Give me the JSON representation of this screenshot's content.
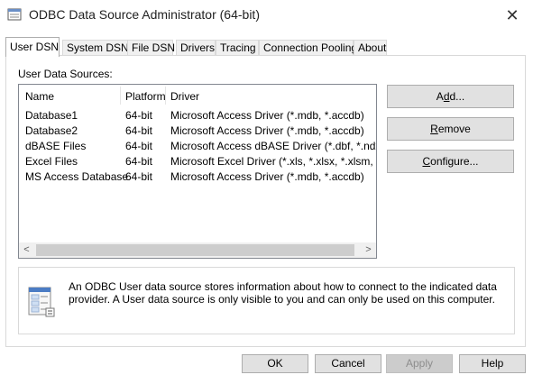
{
  "window": {
    "title": "ODBC Data Source Administrator (64-bit)",
    "close_glyph": "✕"
  },
  "tabs": [
    {
      "label": "User DSN",
      "active": true
    },
    {
      "label": "System DSN"
    },
    {
      "label": "File DSN"
    },
    {
      "label": "Drivers"
    },
    {
      "label": "Tracing"
    },
    {
      "label": "Connection Pooling"
    },
    {
      "label": "About"
    }
  ],
  "user_dsn": {
    "section_label": "User Data Sources:",
    "columns": [
      "Name",
      "Platform",
      "Driver"
    ],
    "rows": [
      {
        "name": "Database1",
        "platform": "64-bit",
        "driver": "Microsoft Access Driver (*.mdb, *.accdb)"
      },
      {
        "name": "Database2",
        "platform": "64-bit",
        "driver": "Microsoft Access Driver (*.mdb, *.accdb)"
      },
      {
        "name": "dBASE Files",
        "platform": "64-bit",
        "driver": "Microsoft Access dBASE Driver (*.dbf, *.ndx, *.m"
      },
      {
        "name": "Excel Files",
        "platform": "64-bit",
        "driver": "Microsoft Excel Driver (*.xls, *.xlsx, *.xlsm, *.xlsb)"
      },
      {
        "name": "MS Access Database",
        "platform": "64-bit",
        "driver": "Microsoft Access Driver (*.mdb, *.accdb)"
      }
    ],
    "scroll_left": "<",
    "scroll_right": ">",
    "buttons": {
      "add_prefix": "A",
      "add_mnemonic": "d",
      "add_suffix": "d...",
      "remove_mnemonic": "R",
      "remove_suffix": "emove",
      "configure_mnemonic": "C",
      "configure_suffix": "onfigure..."
    },
    "info_text": "An ODBC User data source stores information about how to connect to the indicated data provider.   A User data source is only visible to you and can only be used on this computer."
  },
  "footer": {
    "ok": "OK",
    "cancel": "Cancel",
    "apply": "Apply",
    "help": "Help"
  },
  "colors": {
    "button_face": "#e1e1e1",
    "scroll_thumb": "#cdcdcd",
    "tab_inactive": "#f0f0f0"
  }
}
